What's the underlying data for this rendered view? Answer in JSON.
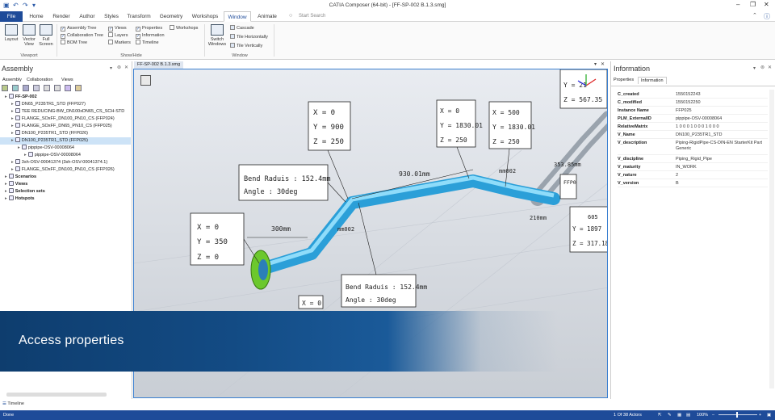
{
  "window": {
    "title": "CATIA Composer (64-bit) - [FF-SP-002 B.1.3.smg]"
  },
  "ribbon": {
    "tabs": [
      {
        "label": "File"
      },
      {
        "label": "Home"
      },
      {
        "label": "Render"
      },
      {
        "label": "Author"
      },
      {
        "label": "Styles"
      },
      {
        "label": "Transform"
      },
      {
        "label": "Geometry"
      },
      {
        "label": "Workshops"
      },
      {
        "label": "Window"
      },
      {
        "label": "Animate"
      }
    ],
    "search_placeholder": "Start Search",
    "viewport_group": {
      "label": "Viewport",
      "buttons": [
        "Layout",
        "Vector View",
        "Full Screen"
      ]
    },
    "showhide_group": {
      "label": "Show/Hide",
      "col1": [
        "Assembly Tree",
        "Collaboration Tree",
        "BOM Tree"
      ],
      "col1_checked": [
        true,
        true,
        false
      ],
      "col2": [
        "Views",
        "Layers",
        "Markers"
      ],
      "col2_checked": [
        true,
        false,
        false
      ],
      "col3": [
        "Properties",
        "Information",
        "Timeline"
      ],
      "col3_checked": [
        true,
        true,
        false
      ],
      "col4": [
        "Workshops"
      ],
      "col4_checked": [
        false
      ]
    },
    "window_group": {
      "label": "Window",
      "switch_label": "Switch Windows",
      "items": [
        "Cascade",
        "Tile Horizontally",
        "Tile Vertically"
      ]
    }
  },
  "left_panel": {
    "title": "Assembly",
    "subtabs": [
      "Assembly",
      "Collaboration",
      "Views"
    ],
    "tree": [
      {
        "label": "FF-SP-002",
        "indent": 0,
        "bold": true
      },
      {
        "label": "DN65_P235TR1_STD (FFP027)",
        "indent": 1
      },
      {
        "label": "TEE REDUCING-BW_DN100xDN65_CS_SCH-STD",
        "indent": 1
      },
      {
        "label": "FLANGE_SOxFF_DN100_PN10_CS (FFP024)",
        "indent": 1
      },
      {
        "label": "FLANGE_SOxFF_DN65_PN10_CS (FFP025)",
        "indent": 1
      },
      {
        "label": "DN100_P235TR1_STD (FFP026)",
        "indent": 1
      },
      {
        "label": "DN100_P235TR1_STD (FFP025)",
        "indent": 1,
        "selected": true
      },
      {
        "label": "pippipe-OSV-00008064",
        "indent": 2
      },
      {
        "label": "pippipe-OSV-00008064",
        "indent": 3
      },
      {
        "label": "3sh-OSV-00041374 (3sh-OSV-00041374.1)",
        "indent": 1
      },
      {
        "label": "FLANGE_SOxFF_DN100_PN10_CS (FFP026)",
        "indent": 1
      },
      {
        "label": "Scenarios",
        "indent": 0,
        "bold": true
      },
      {
        "label": "Views",
        "indent": 0,
        "bold": true
      },
      {
        "label": "Selection sets",
        "indent": 0,
        "bold": true
      },
      {
        "label": "Hotspots",
        "indent": 0,
        "bold": true
      }
    ],
    "timeline_label": "Timeline"
  },
  "viewport": {
    "doc_tab": "FF-SP-002 B.1.3.smg",
    "annotations": {
      "coord1": [
        "X = 0",
        "Y = 900",
        "Z = 250"
      ],
      "coord2": [
        "X = 0",
        "Y = 1830.01",
        "Z = 250"
      ],
      "coord3": [
        "X = 500",
        "Y = 1830.01",
        "Z = 250"
      ],
      "coord4": [
        "X = 0",
        "Y = 350",
        "Z = 0"
      ],
      "coord5": [
        "Y = 21",
        "Z = 567.35"
      ],
      "coord6": [
        "Y = 1897",
        "Z = 317.18"
      ],
      "coord7": [
        "X = 0"
      ],
      "bend1": [
        "Bend Raduis : 152.4mm",
        "Angle : 30deg"
      ],
      "bend2": [
        "Bend Raduis : 152.4mm",
        "Angle : 30deg"
      ],
      "dims": [
        "930.01mm",
        "300mm",
        "mm002",
        "210mm",
        "353.85mm",
        "605",
        "FFP0",
        "mm002"
      ]
    }
  },
  "right_panel": {
    "title": "Information",
    "tabs": [
      "Properties",
      "Information"
    ],
    "rows": [
      {
        "key": "C_created",
        "value": "1550152243"
      },
      {
        "key": "C_modified",
        "value": "1550152250"
      },
      {
        "key": "Instance Name",
        "value": "FFP025"
      },
      {
        "key": "PLM_ExternalID",
        "value": "pippipe-OSV-00008064"
      },
      {
        "key": "RelativeMatrix",
        "value": "1 0 0 0 1 0 0 0 1 0 0 0"
      },
      {
        "key": "V_Name",
        "value": "DN100_P235TR1_STD"
      },
      {
        "key": "V_description",
        "value": "Piping-RigidPipe-CS-DIN-EN StarterKit Part Generic"
      },
      {
        "key": "V_discipline",
        "value": "Piping_Rigid_Pipe"
      },
      {
        "key": "V_maturity",
        "value": "IN_WORK"
      },
      {
        "key": "V_nature",
        "value": "2"
      },
      {
        "key": "V_version",
        "value": "B"
      }
    ]
  },
  "banner": {
    "text": "Access properties"
  },
  "status": {
    "left": "Done",
    "actors": "1 Of 38 Actors",
    "zoom": "100%"
  },
  "colors": {
    "accent": "#1e4b99",
    "pipe": "#3fb3e8",
    "flange": "#7fd43a"
  }
}
